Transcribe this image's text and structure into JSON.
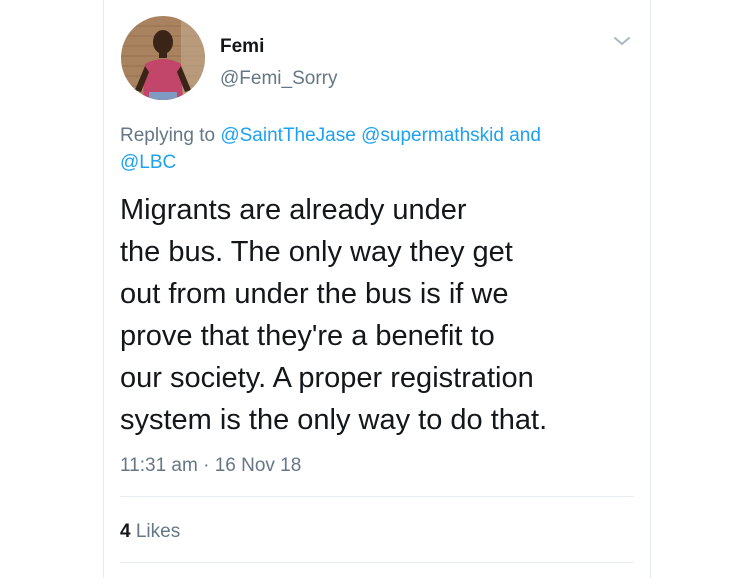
{
  "tweet": {
    "author_name": "Femi",
    "author_handle": "@Femi_Sorry",
    "replying_prefix": "Replying to",
    "reply_users": [
      "@SaintTheJase",
      "@supermathskid"
    ],
    "reply_and": "and",
    "reply_last": "@LBC",
    "text_lines": [
      "Migrants are already under",
      "the bus. The only way they get",
      "out from under the bus is if we",
      "prove that they're a benefit to",
      "our society. A proper registration",
      "system is the only way to do that."
    ],
    "timestamp": "11:31 am · 16 Nov 18",
    "likes_count": "4",
    "likes_label": "Likes"
  },
  "icons": {
    "menu": "chevron-down-icon",
    "avatar": "avatar"
  },
  "colors": {
    "link": "#1da1f2",
    "secondary_text": "#657786",
    "primary_text": "#14171a",
    "divider": "#e6ecf0"
  }
}
